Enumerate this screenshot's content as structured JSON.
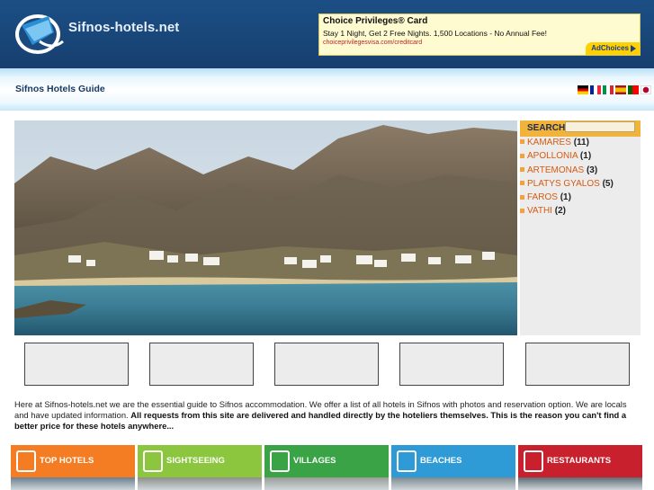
{
  "header": {
    "site_name": "Sifnos-hotels.net",
    "ad": {
      "title": "Choice Privileges® Card",
      "text": "Stay 1 Night, Get 2 Free Nights. 1,500 Locations - No Annual Fee!",
      "url": "choiceprivilegesvisa.com/creditcard",
      "adchoices": "AdChoices"
    }
  },
  "guide": {
    "title": "Sifnos Hotels Guide",
    "flags": [
      "german-flag-icon",
      "french-flag-icon",
      "italian-flag-icon",
      "spanish-flag-icon",
      "portuguese-flag-icon",
      "japanese-flag-icon"
    ]
  },
  "sidebar": {
    "search_label": "SEARCH",
    "villages": [
      {
        "name": "KAMARES",
        "count": "(11)"
      },
      {
        "name": "APOLLONIA",
        "count": "(1)"
      },
      {
        "name": "ARTEMONAS",
        "count": "(3)"
      },
      {
        "name": "PLATYS GYALOS",
        "count": "(5)"
      },
      {
        "name": "FAROS",
        "count": "(1)"
      },
      {
        "name": "VATHI",
        "count": "(2)"
      }
    ]
  },
  "intro": {
    "plain": "Here at Sifnos-hotels.net we are the essential guide to Sifnos accommodation. We offer a list of all hotels in Sifnos with photos and reservation option. We are locals and have updated information. ",
    "bold": "All requests from this site are delivered and handled directly by the hoteliers themselves. This is the reason you can't find a better price for these hotels anywhere..."
  },
  "categories": [
    {
      "label": "TOP HOTELS",
      "icon": "hotel-icon",
      "color": "#f47c22"
    },
    {
      "label": "SIGHTSEEING",
      "icon": "camera-icon",
      "color": "#8bc63e"
    },
    {
      "label": "VILLAGES",
      "icon": "village-icon",
      "color": "#3aa345"
    },
    {
      "label": "BEACHES",
      "icon": "beach-umbrella-icon",
      "color": "#2e9bd6"
    },
    {
      "label": "RESTAURANTS",
      "icon": "cutlery-icon",
      "color": "#c8202c"
    }
  ],
  "colors": {
    "header_bg": "#1c4f86",
    "search_bar": "#f2b33a",
    "village_link": "#d65a10"
  }
}
